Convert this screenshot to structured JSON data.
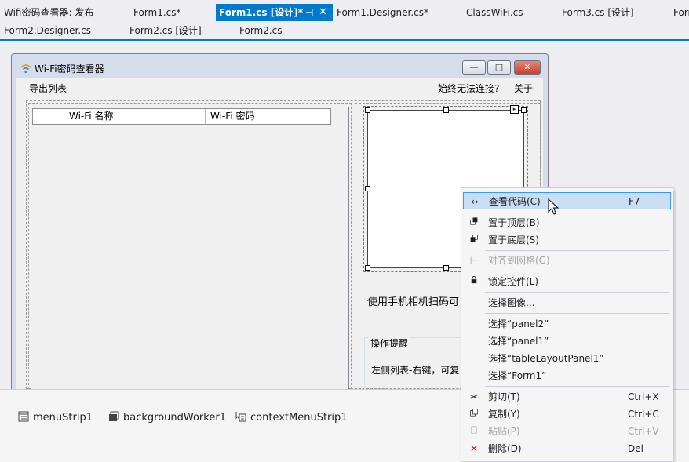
{
  "document_tabs": {
    "row1": [
      {
        "label": "Wifi密码查看器: 发布",
        "active": false
      },
      {
        "label": "Form1.cs*",
        "active": false
      },
      {
        "label": "Form1.cs [设计]*",
        "active": true
      },
      {
        "label": "Form1.Designer.cs*",
        "active": false
      },
      {
        "label": "ClassWiFi.cs",
        "active": false
      },
      {
        "label": "Form3.cs [设计]",
        "active": false
      },
      {
        "label": "Form",
        "active": false
      }
    ],
    "row2": [
      {
        "label": "Form2.Designer.cs"
      },
      {
        "label": "Form2.cs [设计]"
      },
      {
        "label": "Form2.cs"
      }
    ],
    "pin_glyph": "⊣",
    "close_glyph": "✕",
    "accent": "#007acc"
  },
  "form": {
    "title": "Wi-Fi密码查看器",
    "minimize_glyph": "—",
    "maximize_glyph": "□",
    "close_glyph": "✕",
    "menu": {
      "export": "导出列表",
      "cant_connect": "始终无法连接?",
      "about": "关于"
    },
    "list_columns": [
      "",
      "Wi-Fi 名称",
      "Wi-Fi 密码"
    ],
    "scan_text": "使用手机相机扫码可",
    "tips_group_title": "操作提醒",
    "tips_text": "左侧列表-右键，可复"
  },
  "tray": {
    "items": [
      {
        "label": "menuStrip1",
        "icon": "menustrip-icon"
      },
      {
        "label": "backgroundWorker1",
        "icon": "backgroundworker-icon"
      },
      {
        "label": "contextMenuStrip1",
        "icon": "contextmenustrip-icon"
      }
    ]
  },
  "context_menu": {
    "items": [
      {
        "label": "查看代码(C)",
        "shortcut": "F7",
        "icon": "code-icon",
        "glyph": "‹›",
        "highlighted": true,
        "disabled": false
      },
      {
        "label": "置于顶层(B)",
        "shortcut": "",
        "icon": "bring-to-front-icon",
        "glyph": "",
        "highlighted": false,
        "disabled": false
      },
      {
        "label": "置于底层(S)",
        "shortcut": "",
        "icon": "send-to-back-icon",
        "glyph": "",
        "highlighted": false,
        "disabled": false
      },
      {
        "label": "对齐到网格(G)",
        "shortcut": "",
        "icon": "align-grid-icon",
        "glyph": "⊢",
        "highlighted": false,
        "disabled": true
      },
      {
        "label": "锁定控件(L)",
        "shortcut": "",
        "icon": "lock-icon",
        "glyph": "",
        "highlighted": false,
        "disabled": false
      },
      {
        "label": "选择图像...",
        "shortcut": "",
        "icon": "",
        "glyph": "",
        "highlighted": false,
        "disabled": false
      },
      {
        "label": "选择“panel2”",
        "shortcut": "",
        "icon": "",
        "glyph": "",
        "highlighted": false,
        "disabled": false
      },
      {
        "label": "选择“panel1”",
        "shortcut": "",
        "icon": "",
        "glyph": "",
        "highlighted": false,
        "disabled": false
      },
      {
        "label": "选择“tableLayoutPanel1”",
        "shortcut": "",
        "icon": "",
        "glyph": "",
        "highlighted": false,
        "disabled": false
      },
      {
        "label": "选择“Form1”",
        "shortcut": "",
        "icon": "",
        "glyph": "",
        "highlighted": false,
        "disabled": false
      },
      {
        "label": "剪切(T)",
        "shortcut": "Ctrl+X",
        "icon": "cut-icon",
        "glyph": "✂",
        "highlighted": false,
        "disabled": false
      },
      {
        "label": "复制(Y)",
        "shortcut": "Ctrl+C",
        "icon": "copy-icon",
        "glyph": "",
        "highlighted": false,
        "disabled": false
      },
      {
        "label": "粘贴(P)",
        "shortcut": "Ctrl+V",
        "icon": "paste-icon",
        "glyph": "",
        "highlighted": false,
        "disabled": true
      },
      {
        "label": "删除(D)",
        "shortcut": "Del",
        "icon": "delete-icon",
        "glyph": "✕",
        "highlighted": false,
        "disabled": false
      }
    ],
    "highlight_color": "#c9def5"
  }
}
